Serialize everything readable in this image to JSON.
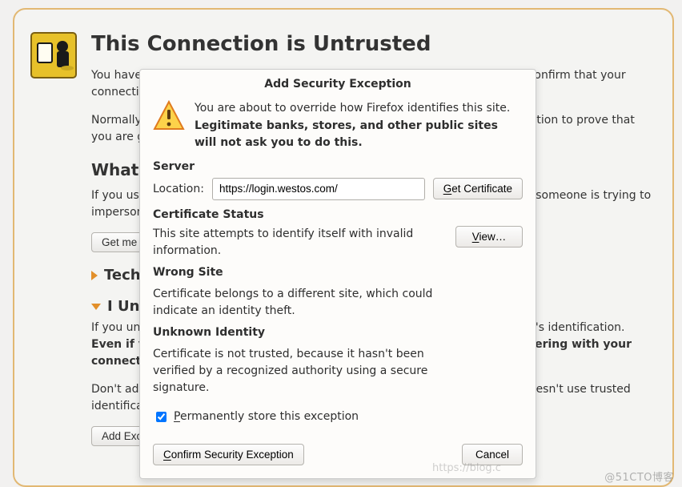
{
  "page": {
    "title": "This Connection is Untrusted",
    "p1": "You have asked Firefox to connect securely to login.westos.com, but we can't confirm that your connection is secure.",
    "p2": "Normally, when you try to connect securely, sites will present trusted identification to prove that you are going to the right place. However, this site's identity can't be verified.",
    "h2": "What Should I Do?",
    "p3": "If you usually connect to this site without problems, this error could mean that someone is trying to impersonate the site, and you shouldn't continue.",
    "get_me_out": "Get me out of here!",
    "tech": "Technical Details",
    "risk": "I Understand the Risks",
    "p4a": "If you understand what's going on, you can tell Firefox to start trusting this site's identification. ",
    "p4b": "Even if you trust the site, this error could mean that someone is tampering with your connection.",
    "p5": "Don't add an exception unless you know there's a good reason why this site doesn't use trusted identification.",
    "add_exception": "Add Exception…"
  },
  "dialog": {
    "title": "Add Security Exception",
    "intro1": "You are about to override how Firefox identifies this site.",
    "intro2": "Legitimate banks, stores, and other public sites will not ask you to do this.",
    "server_h": "Server",
    "location_label": "Location:",
    "location_value": "https://login.westos.com/",
    "get_cert": "Get Certificate",
    "cert_status_h": "Certificate Status",
    "cs1": "This site attempts to identify itself with invalid information.",
    "view": "View…",
    "wrong_site": "Wrong Site",
    "cs2": "Certificate belongs to a different site, which could indicate an identity theft.",
    "unknown_identity": "Unknown Identity",
    "cs3": "Certificate is not trusted, because it hasn't been verified by a recognized authority using a secure signature.",
    "perm_label": "Permanently store this exception",
    "confirm": "Confirm Security Exception",
    "cancel": "Cancel"
  },
  "watermarks": {
    "w1": "https://blog.c",
    "w2": "@51CTO博客"
  }
}
